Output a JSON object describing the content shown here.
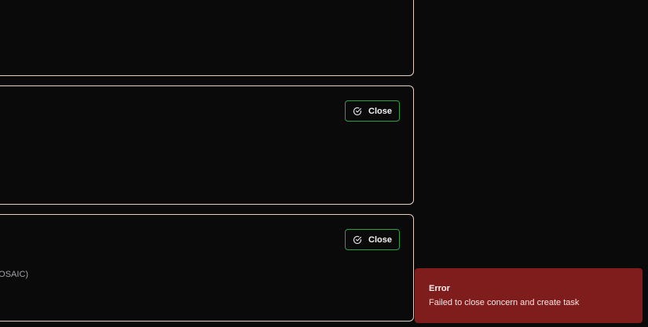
{
  "cards": [
    {
      "close_label": null,
      "text": null
    },
    {
      "close_label": "Close",
      "text": null
    },
    {
      "close_label": "Close",
      "text": "MOSAIC)"
    }
  ],
  "close_icon": "check-circle-icon",
  "toast": {
    "title": "Error",
    "message": "Failed to close concern and create task",
    "status_color": "#7f1d1d"
  },
  "colors": {
    "background": "#0a0a0b",
    "card_border": "#e4cfc4",
    "button_border": "#2ea043"
  }
}
